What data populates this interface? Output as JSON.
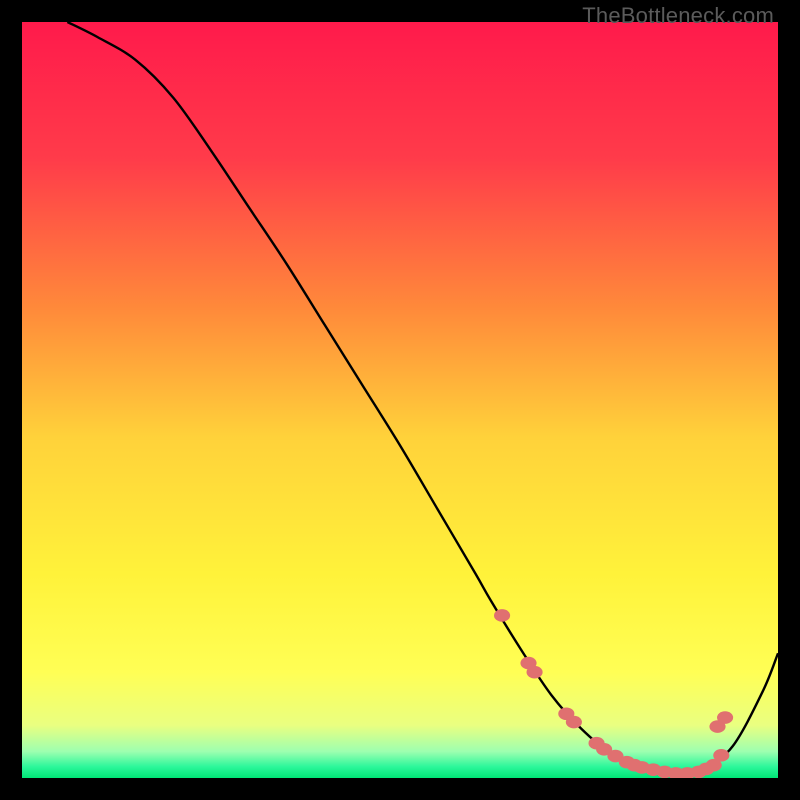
{
  "watermark": "TheBottleneck.com",
  "chart_data": {
    "type": "line",
    "title": "",
    "xlabel": "",
    "ylabel": "",
    "xlim": [
      0,
      100
    ],
    "ylim": [
      0,
      100
    ],
    "background_gradient_stops": [
      {
        "offset": 0.0,
        "color": "#ff1a4b"
      },
      {
        "offset": 0.18,
        "color": "#ff3b4a"
      },
      {
        "offset": 0.38,
        "color": "#ff8a3a"
      },
      {
        "offset": 0.55,
        "color": "#ffd23a"
      },
      {
        "offset": 0.73,
        "color": "#fff23a"
      },
      {
        "offset": 0.86,
        "color": "#ffff55"
      },
      {
        "offset": 0.93,
        "color": "#eaff80"
      },
      {
        "offset": 0.965,
        "color": "#9dffb0"
      },
      {
        "offset": 0.985,
        "color": "#2cf79b"
      },
      {
        "offset": 1.0,
        "color": "#00e676"
      }
    ],
    "series": [
      {
        "name": "bottleneck-curve",
        "color": "#000000",
        "stroke_width": 2.4,
        "x": [
          6,
          10,
          15,
          20,
          25,
          30,
          35,
          40,
          45,
          50,
          55,
          60,
          62,
          66,
          70,
          74,
          78,
          82,
          86,
          88,
          90,
          94,
          98,
          100
        ],
        "y": [
          100,
          98,
          95,
          90,
          83,
          75.5,
          68,
          60,
          52,
          44,
          35.5,
          27,
          23.5,
          17,
          11,
          6.5,
          3.2,
          1.4,
          0.6,
          0.6,
          1.0,
          4.2,
          11.5,
          16.5
        ]
      }
    ],
    "markers": {
      "name": "highlight-points",
      "color": "#e07070",
      "radius": 7,
      "points": [
        {
          "x": 63.5,
          "y": 21.5
        },
        {
          "x": 67.0,
          "y": 15.2
        },
        {
          "x": 67.8,
          "y": 14.0
        },
        {
          "x": 72.0,
          "y": 8.5
        },
        {
          "x": 73.0,
          "y": 7.4
        },
        {
          "x": 76.0,
          "y": 4.6
        },
        {
          "x": 77.0,
          "y": 3.8
        },
        {
          "x": 78.5,
          "y": 2.9
        },
        {
          "x": 80.0,
          "y": 2.1
        },
        {
          "x": 81.0,
          "y": 1.7
        },
        {
          "x": 82.0,
          "y": 1.4
        },
        {
          "x": 83.5,
          "y": 1.1
        },
        {
          "x": 85.0,
          "y": 0.8
        },
        {
          "x": 86.5,
          "y": 0.6
        },
        {
          "x": 88.0,
          "y": 0.6
        },
        {
          "x": 89.5,
          "y": 0.8
        },
        {
          "x": 90.5,
          "y": 1.2
        },
        {
          "x": 91.5,
          "y": 1.7
        },
        {
          "x": 92.5,
          "y": 3.0
        },
        {
          "x": 92.0,
          "y": 6.8
        },
        {
          "x": 93.0,
          "y": 8.0
        }
      ]
    }
  }
}
